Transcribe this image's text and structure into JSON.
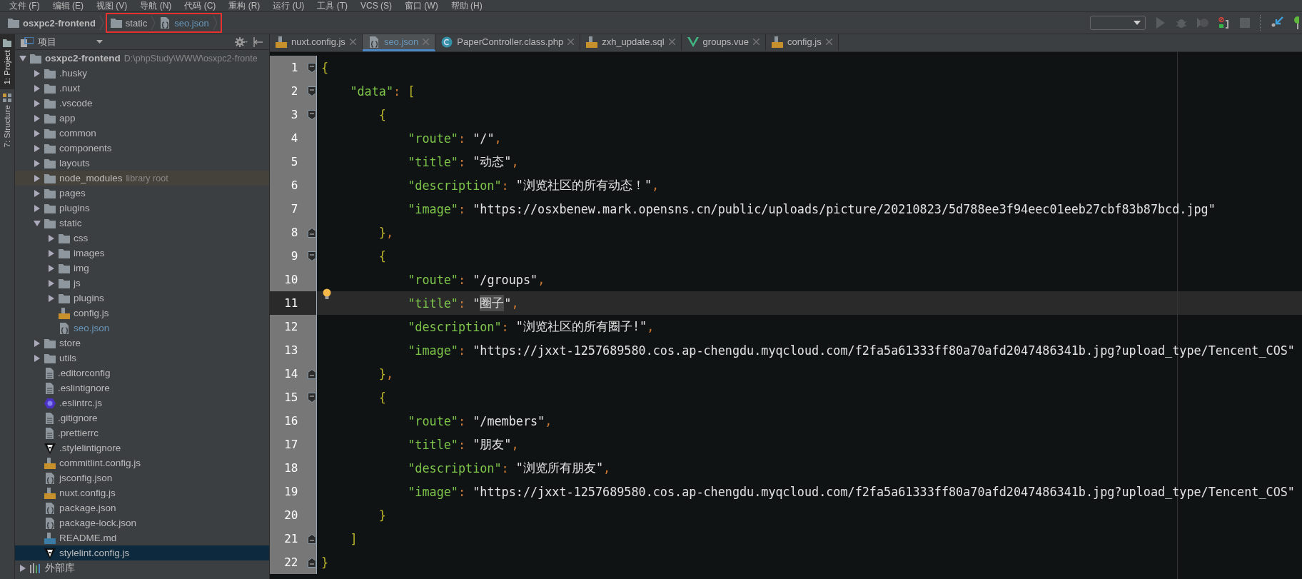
{
  "menu": [
    "文件 (F)",
    "编辑 (E)",
    "视图 (V)",
    "导航 (N)",
    "代码 (C)",
    "重构 (R)",
    "运行 (U)",
    "工具 (T)",
    "VCS (S)",
    "窗口 (W)",
    "帮助 (H)"
  ],
  "breadcrumbs": [
    {
      "label": "osxpc2-frontend",
      "kind": "project",
      "marked": false
    },
    {
      "label": "static",
      "kind": "folder",
      "marked": true
    },
    {
      "label": "seo.json",
      "kind": "json-file",
      "marked": true
    }
  ],
  "tool_strip": [
    {
      "label": "1: Project",
      "selected": true
    },
    {
      "label": "7: Structure",
      "selected": false
    }
  ],
  "project_panel": {
    "view": "项目"
  },
  "tree": [
    {
      "label": "osxpc2-frontend",
      "kind": "project",
      "hint": "D:\\phpStudy\\WWW\\osxpc2-fronte",
      "expanded": true,
      "selected": false,
      "children": [
        {
          "label": ".husky",
          "kind": "folder",
          "expanded": false,
          "selected": false
        },
        {
          "label": ".nuxt",
          "kind": "folder",
          "expanded": false,
          "selected": false
        },
        {
          "label": ".vscode",
          "kind": "folder",
          "expanded": false,
          "selected": false
        },
        {
          "label": "app",
          "kind": "folder",
          "expanded": false,
          "selected": false
        },
        {
          "label": "common",
          "kind": "folder",
          "expanded": false,
          "selected": false
        },
        {
          "label": "components",
          "kind": "folder",
          "expanded": false,
          "selected": false
        },
        {
          "label": "layouts",
          "kind": "folder",
          "expanded": false,
          "selected": false
        },
        {
          "label": "node_modules",
          "kind": "library-folder",
          "hint": "library root",
          "expanded": false,
          "selected": false
        },
        {
          "label": "pages",
          "kind": "folder",
          "expanded": false,
          "selected": false
        },
        {
          "label": "plugins",
          "kind": "folder",
          "expanded": false,
          "selected": false
        },
        {
          "label": "static",
          "kind": "folder",
          "expanded": true,
          "selected": false,
          "children": [
            {
              "label": "css",
              "kind": "folder",
              "expanded": false,
              "selected": false
            },
            {
              "label": "images",
              "kind": "folder",
              "expanded": false,
              "selected": false
            },
            {
              "label": "img",
              "kind": "folder",
              "expanded": false,
              "selected": false
            },
            {
              "label": "js",
              "kind": "folder",
              "expanded": false,
              "selected": false
            },
            {
              "label": "plugins",
              "kind": "folder",
              "expanded": false,
              "selected": false
            },
            {
              "label": "config.js",
              "kind": "js-file",
              "open": false,
              "selected": false
            },
            {
              "label": "seo.json",
              "kind": "json-file",
              "open": true,
              "selected": false
            }
          ]
        },
        {
          "label": "store",
          "kind": "folder",
          "expanded": false,
          "selected": false
        },
        {
          "label": "utils",
          "kind": "folder",
          "expanded": false,
          "selected": false
        },
        {
          "label": ".editorconfig",
          "kind": "text-file",
          "open": false,
          "selected": false
        },
        {
          "label": ".eslintignore",
          "kind": "text-file",
          "open": false,
          "selected": false
        },
        {
          "label": ".eslintrc.js",
          "kind": "eslint-file",
          "open": false,
          "selected": false
        },
        {
          "label": ".gitignore",
          "kind": "text-file",
          "open": false,
          "selected": false
        },
        {
          "label": ".prettierrc",
          "kind": "text-file",
          "open": false,
          "selected": false
        },
        {
          "label": ".stylelintignore",
          "kind": "stylelint-file",
          "open": false,
          "selected": false
        },
        {
          "label": "commitlint.config.js",
          "kind": "js-file",
          "open": false,
          "selected": false
        },
        {
          "label": "jsconfig.json",
          "kind": "json-file",
          "open": false,
          "selected": false
        },
        {
          "label": "nuxt.config.js",
          "kind": "js-file",
          "open": false,
          "selected": false
        },
        {
          "label": "package.json",
          "kind": "json-file",
          "open": false,
          "selected": false
        },
        {
          "label": "package-lock.json",
          "kind": "json-file",
          "open": false,
          "selected": false
        },
        {
          "label": "README.md",
          "kind": "md-file",
          "open": false,
          "selected": false
        },
        {
          "label": "stylelint.config.js",
          "kind": "stylelint-file",
          "open": false,
          "selected": true
        }
      ]
    },
    {
      "label": "外部库",
      "kind": "libraries",
      "expanded": false,
      "selected": false
    }
  ],
  "tabs": [
    {
      "label": "nuxt.config.js",
      "kind": "js-file",
      "selected": false
    },
    {
      "label": "seo.json",
      "kind": "json-file",
      "selected": true
    },
    {
      "label": "PaperController.class.php",
      "kind": "php-file",
      "selected": false
    },
    {
      "label": "zxh_update.sql",
      "kind": "sql-file",
      "selected": false
    },
    {
      "label": "groups.vue",
      "kind": "vue-file",
      "selected": false
    },
    {
      "label": "config.js",
      "kind": "js-file",
      "selected": false
    }
  ],
  "code_lines": [
    {
      "number": "1",
      "fold_open": true,
      "fold_close": false,
      "current": false,
      "tokens": [
        {
          "kind": "brace",
          "text": "{"
        }
      ]
    },
    {
      "number": "2",
      "fold_open": true,
      "fold_close": false,
      "current": false,
      "tokens": [
        {
          "kind": "key",
          "text": "    \"data\""
        },
        {
          "kind": "punct",
          "text": ": "
        },
        {
          "kind": "brace",
          "text": "["
        }
      ]
    },
    {
      "number": "3",
      "fold_open": true,
      "fold_close": false,
      "current": false,
      "tokens": [
        {
          "kind": "brace",
          "text": "        {"
        }
      ]
    },
    {
      "number": "4",
      "fold_open": false,
      "fold_close": false,
      "current": false,
      "tokens": [
        {
          "kind": "key",
          "text": "            \"route\""
        },
        {
          "kind": "punct",
          "text": ": "
        },
        {
          "kind": "string",
          "text": "\"/\""
        },
        {
          "kind": "punct",
          "text": ","
        }
      ]
    },
    {
      "number": "5",
      "fold_open": false,
      "fold_close": false,
      "current": false,
      "tokens": [
        {
          "kind": "key",
          "text": "            \"title\""
        },
        {
          "kind": "punct",
          "text": ": "
        },
        {
          "kind": "string",
          "text": "\"动态\""
        },
        {
          "kind": "punct",
          "text": ","
        }
      ]
    },
    {
      "number": "6",
      "fold_open": false,
      "fold_close": false,
      "current": false,
      "tokens": [
        {
          "kind": "key",
          "text": "            \"description\""
        },
        {
          "kind": "punct",
          "text": ": "
        },
        {
          "kind": "string",
          "text": "\"浏览社区的所有动态！\""
        },
        {
          "kind": "punct",
          "text": ","
        }
      ]
    },
    {
      "number": "7",
      "fold_open": false,
      "fold_close": false,
      "current": false,
      "tokens": [
        {
          "kind": "key",
          "text": "            \"image\""
        },
        {
          "kind": "punct",
          "text": ": "
        },
        {
          "kind": "string",
          "text": "\"https://osxbenew.mark.opensns.cn/public/uploads/picture/20210823/5d788ee3f94eec01eeb27cbf83b87bcd.jpg\""
        }
      ]
    },
    {
      "number": "8",
      "fold_open": false,
      "fold_close": true,
      "current": false,
      "tokens": [
        {
          "kind": "brace",
          "text": "        }"
        },
        {
          "kind": "punct",
          "text": ","
        }
      ]
    },
    {
      "number": "9",
      "fold_open": true,
      "fold_close": false,
      "current": false,
      "tokens": [
        {
          "kind": "brace",
          "text": "        {"
        }
      ]
    },
    {
      "number": "10",
      "fold_open": false,
      "fold_close": false,
      "current": false,
      "tokens": [
        {
          "kind": "key",
          "text": "            \"route\""
        },
        {
          "kind": "punct",
          "text": ": "
        },
        {
          "kind": "string",
          "text": "\"/groups\""
        },
        {
          "kind": "punct",
          "text": ","
        }
      ]
    },
    {
      "number": "11",
      "fold_open": false,
      "fold_close": false,
      "current": true,
      "bulb": true,
      "tokens": [
        {
          "kind": "key",
          "text": "            \"title\""
        },
        {
          "kind": "punct",
          "text": ": "
        },
        {
          "kind": "string",
          "text": "\""
        },
        {
          "kind": "match",
          "text": "圈子"
        },
        {
          "kind": "string",
          "text": "\""
        },
        {
          "kind": "punct",
          "text": ","
        }
      ]
    },
    {
      "number": "12",
      "fold_open": false,
      "fold_close": false,
      "current": false,
      "tokens": [
        {
          "kind": "key",
          "text": "            \"description\""
        },
        {
          "kind": "punct",
          "text": ": "
        },
        {
          "kind": "string",
          "text": "\"浏览社区的所有圈子!\""
        },
        {
          "kind": "punct",
          "text": ","
        }
      ]
    },
    {
      "number": "13",
      "fold_open": false,
      "fold_close": false,
      "current": false,
      "tokens": [
        {
          "kind": "key",
          "text": "            \"image\""
        },
        {
          "kind": "punct",
          "text": ": "
        },
        {
          "kind": "string",
          "text": "\"https://jxxt-1257689580.cos.ap-chengdu.myqcloud.com/f2fa5a61333ff80a70afd2047486341b.jpg?upload_type/Tencent_COS\""
        }
      ]
    },
    {
      "number": "14",
      "fold_open": false,
      "fold_close": true,
      "current": false,
      "tokens": [
        {
          "kind": "brace",
          "text": "        }"
        },
        {
          "kind": "punct",
          "text": ","
        }
      ]
    },
    {
      "number": "15",
      "fold_open": true,
      "fold_close": false,
      "current": false,
      "tokens": [
        {
          "kind": "brace",
          "text": "        {"
        }
      ]
    },
    {
      "number": "16",
      "fold_open": false,
      "fold_close": false,
      "current": false,
      "tokens": [
        {
          "kind": "key",
          "text": "            \"route\""
        },
        {
          "kind": "punct",
          "text": ": "
        },
        {
          "kind": "string",
          "text": "\"/members\""
        },
        {
          "kind": "punct",
          "text": ","
        }
      ]
    },
    {
      "number": "17",
      "fold_open": false,
      "fold_close": false,
      "current": false,
      "tokens": [
        {
          "kind": "key",
          "text": "            \"title\""
        },
        {
          "kind": "punct",
          "text": ": "
        },
        {
          "kind": "string",
          "text": "\"朋友\""
        },
        {
          "kind": "punct",
          "text": ","
        }
      ]
    },
    {
      "number": "18",
      "fold_open": false,
      "fold_close": false,
      "current": false,
      "tokens": [
        {
          "kind": "key",
          "text": "            \"description\""
        },
        {
          "kind": "punct",
          "text": ": "
        },
        {
          "kind": "string",
          "text": "\"浏览所有朋友\""
        },
        {
          "kind": "punct",
          "text": ","
        }
      ]
    },
    {
      "number": "19",
      "fold_open": false,
      "fold_close": false,
      "current": false,
      "tokens": [
        {
          "kind": "key",
          "text": "            \"image\""
        },
        {
          "kind": "punct",
          "text": ": "
        },
        {
          "kind": "string",
          "text": "\"https://jxxt-1257689580.cos.ap-chengdu.myqcloud.com/f2fa5a61333ff80a70afd2047486341b.jpg?upload_type/Tencent_COS\""
        }
      ]
    },
    {
      "number": "20",
      "fold_open": false,
      "fold_close": false,
      "current": false,
      "tokens": [
        {
          "kind": "brace",
          "text": "        }"
        }
      ]
    },
    {
      "number": "21",
      "fold_open": false,
      "fold_close": true,
      "current": false,
      "tokens": [
        {
          "kind": "brace",
          "text": "    ]"
        }
      ]
    },
    {
      "number": "22",
      "fold_open": false,
      "fold_close": true,
      "current": false,
      "tokens": [
        {
          "kind": "brace",
          "text": "}"
        }
      ]
    }
  ]
}
